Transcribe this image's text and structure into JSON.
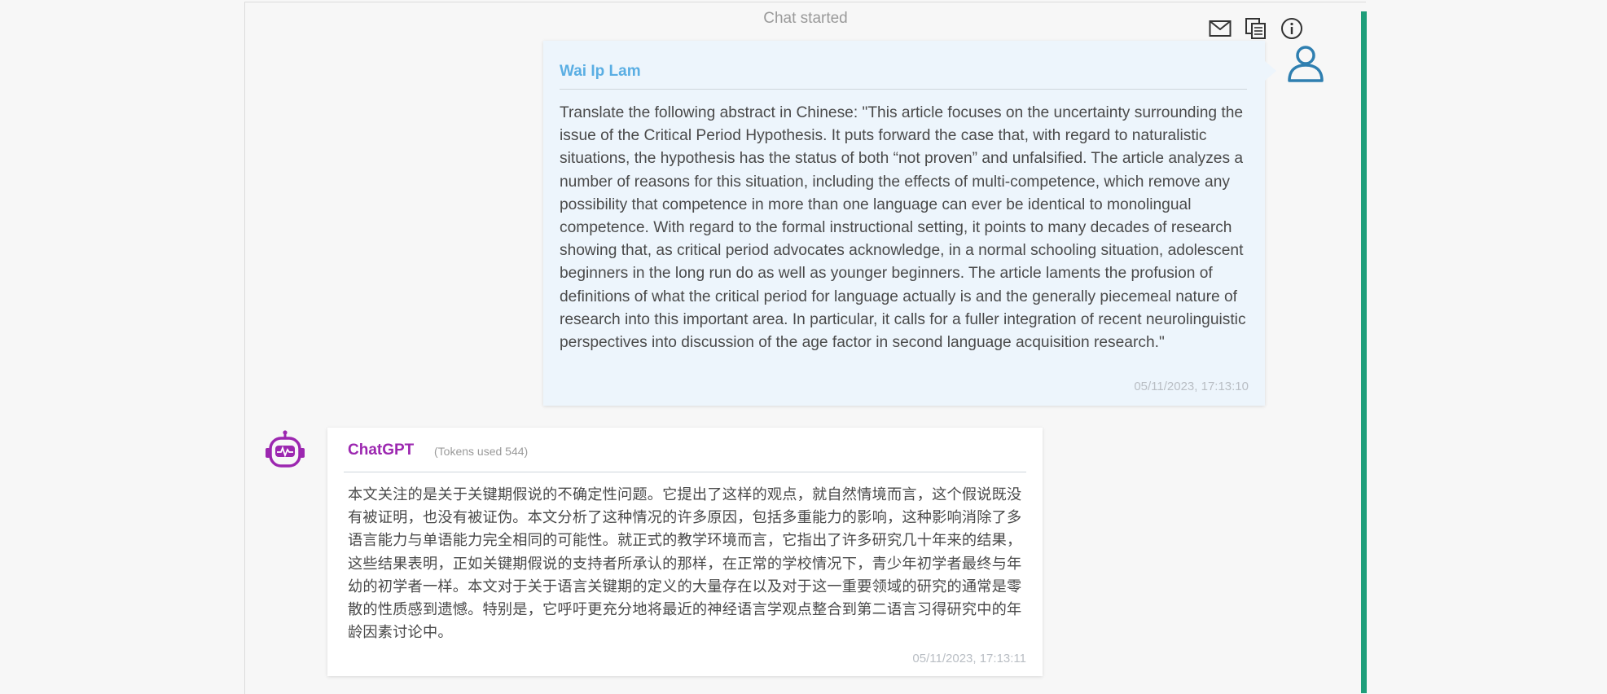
{
  "chat": {
    "status": "Chat started",
    "toolbar_icons": [
      "mail-icon",
      "copy-icon",
      "info-icon"
    ]
  },
  "messages": [
    {
      "sender": "Wai Ip Lam",
      "role": "user",
      "text": "Translate the following abstract in Chinese: \"This article focuses on the uncertainty surrounding the issue of the Critical Period Hypothesis. It puts forward the case that, with regard to naturalistic situations, the hypothesis has the status of both “not proven” and unfalsified. The article analyzes a number of reasons for this situation, including the effects of multi-competence, which remove any possibility that competence in more than one language can ever be identical to monolingual competence. With regard to the formal instructional setting, it points to many decades of research showing that, as critical period advocates acknowledge, in a normal schooling situation, adolescent beginners in the long run do as well as younger beginners. The article laments the profusion of definitions of what the critical period for language actually is and the generally piecemeal nature of research into this important area. In particular, it calls for a fuller integration of recent neurolinguistic perspectives into discussion of the age factor in second language acquisition research.\"",
      "timestamp": "05/11/2023, 17:13:10",
      "avatar_icon": "user-icon"
    },
    {
      "sender": "ChatGPT",
      "role": "assistant",
      "tokens": "(Tokens used 544)",
      "text": "本文关注的是关于关键期假说的不确定性问题。它提出了这样的观点，就自然情境而言，这个假说既没有被证明，也没有被证伪。本文分析了这种情况的许多原因，包括多重能力的影响，这种影响消除了多语言能力与单语能力完全相同的可能性。就正式的教学环境而言，它指出了许多研究几十年来的结果，这些结果表明，正如关键期假说的支持者所承认的那样，在正常的学校情况下，青少年初学者最终与年幼的初学者一样。本文对于关于语言关键期的定义的大量存在以及对于这一重要领域的研究的通常是零散的性质感到遗憾。特别是，它呼吁更充分地将最近的神经语言学观点整合到第二语言习得研究中的年龄因素讨论中。",
      "timestamp": "05/11/2023, 17:13:11",
      "avatar_icon": "robot-icon"
    }
  ],
  "colors": {
    "user_name": "#5aaee3",
    "bot_name": "#9c27b0",
    "user_bubble": "#edf5fc",
    "accent_bar": "#1e9e7a",
    "user_avatar": "#2f7fb0"
  }
}
